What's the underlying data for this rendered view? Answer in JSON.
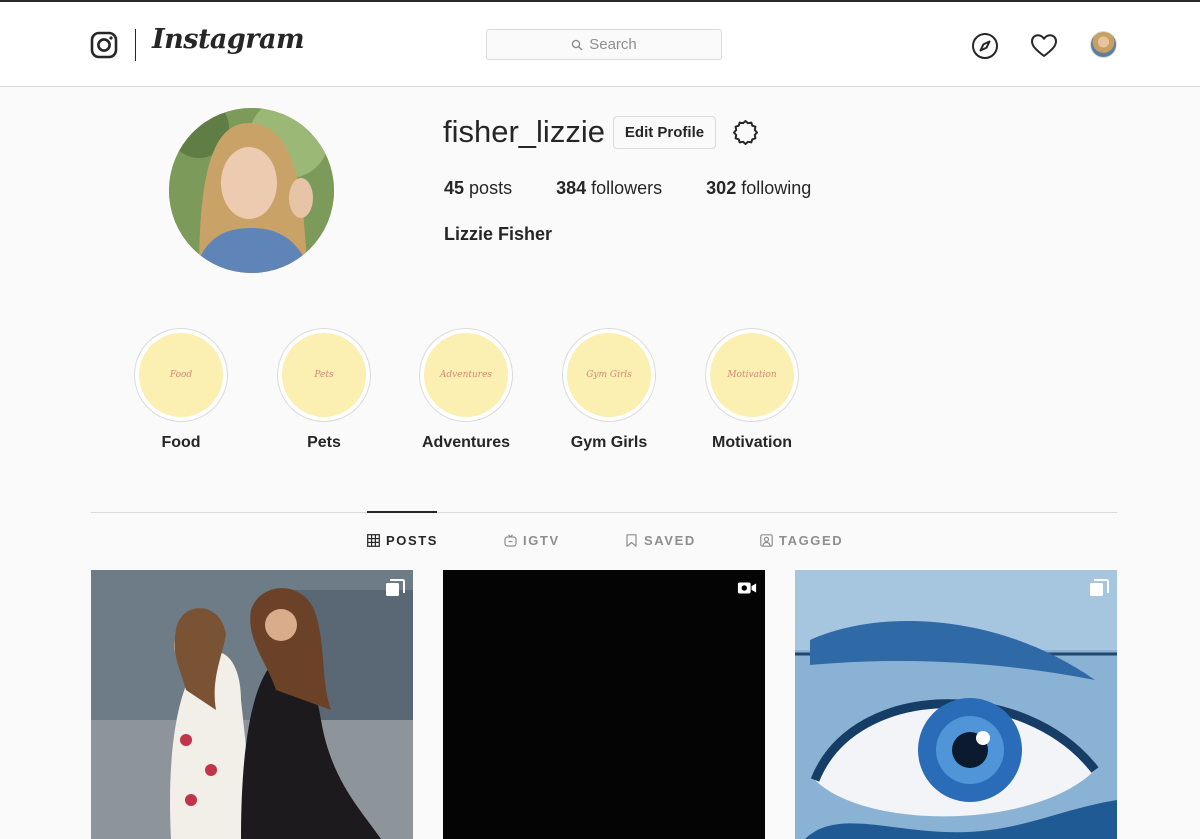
{
  "header": {
    "brand_name": "Instagram",
    "search": {
      "placeholder": "Search",
      "icon": "search-icon"
    },
    "nav_icons": [
      "compass-icon",
      "heart-icon",
      "avatar"
    ]
  },
  "profile": {
    "username": "fisher_lizzie",
    "edit_button_label": "Edit Profile",
    "stats": {
      "posts_count": "45",
      "posts_label": "posts",
      "followers_count": "384",
      "followers_label": "followers",
      "following_count": "302",
      "following_label": "following"
    },
    "full_name": "Lizzie Fisher"
  },
  "highlights": [
    {
      "cover_text": "Food",
      "label": "Food"
    },
    {
      "cover_text": "Pets",
      "label": "Pets"
    },
    {
      "cover_text": "Adventures",
      "label": "Adventures"
    },
    {
      "cover_text": "Gym Girls",
      "label": "Gym Girls"
    },
    {
      "cover_text": "Motivation",
      "label": "Motivation"
    }
  ],
  "tabs": [
    {
      "label": "POSTS",
      "icon": "grid-icon",
      "active": true
    },
    {
      "label": "IGTV",
      "icon": "igtv-icon",
      "active": false
    },
    {
      "label": "SAVED",
      "icon": "bookmark-icon",
      "active": false
    },
    {
      "label": "TAGGED",
      "icon": "tagged-icon",
      "active": false
    }
  ],
  "posts": [
    {
      "type": "carousel",
      "badge_icon": "multiple-photos-icon"
    },
    {
      "type": "video",
      "badge_icon": "video-icon"
    },
    {
      "type": "carousel",
      "badge_icon": "multiple-photos-icon"
    }
  ],
  "colors": {
    "page_bg": "#fafafa",
    "text": "#262626",
    "muted": "#8e8e8e",
    "border": "#dbdbdb",
    "highlight_fill": "#fbefb2",
    "highlight_text": "#d8867a"
  }
}
